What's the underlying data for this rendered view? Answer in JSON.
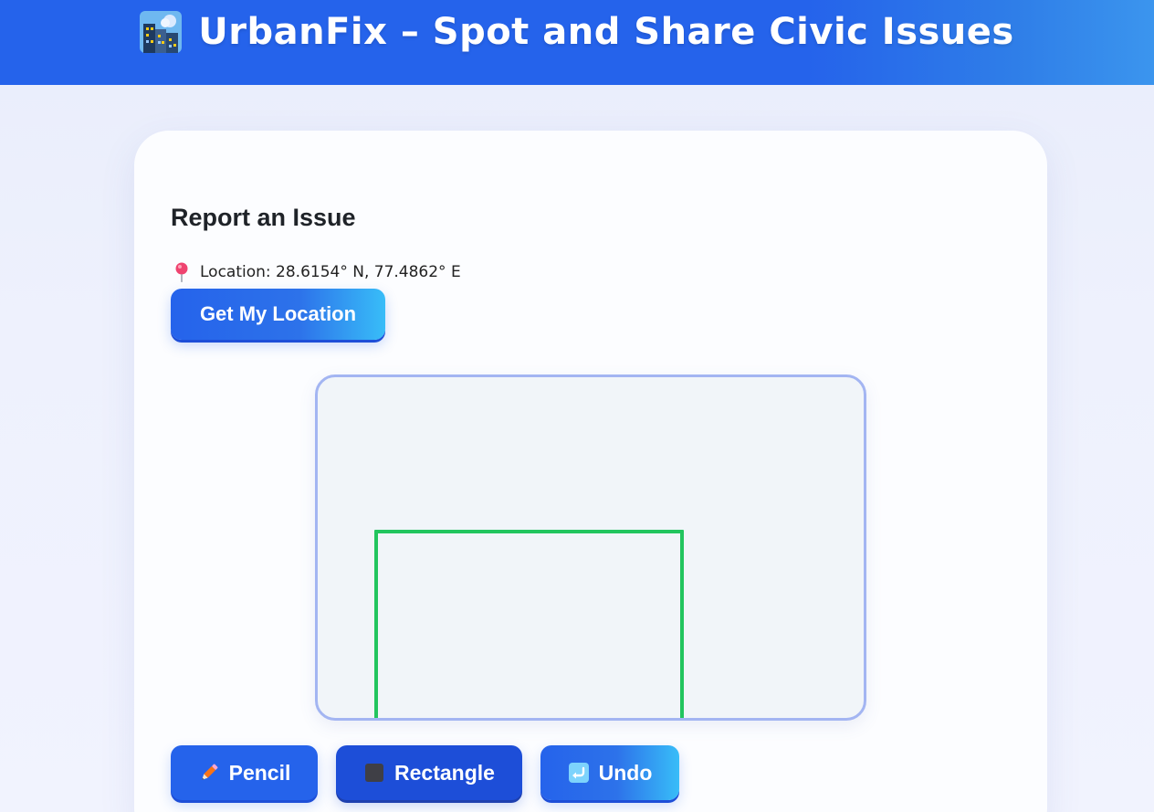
{
  "header": {
    "title": "UrbanFix – Spot and Share Civic Issues",
    "icon": "city-buildings-icon"
  },
  "report": {
    "section_title": "Report an Issue",
    "location_icon": "pin-icon",
    "location_text": "Location: 28.6154° N, 77.4862° E",
    "get_location_label": "Get My Location"
  },
  "toolbar": {
    "pencil_label": "Pencil",
    "rectangle_label": "Rectangle",
    "undo_label": "Undo",
    "selected_tool": "Rectangle"
  },
  "colors": {
    "primary": "#2563eb",
    "primary_dark": "#1d4ed8",
    "accent_light": "#38bdf8",
    "canvas_bg": "#f1f5f9",
    "canvas_border": "#a3b5f2",
    "stroke": "#22c55e"
  }
}
